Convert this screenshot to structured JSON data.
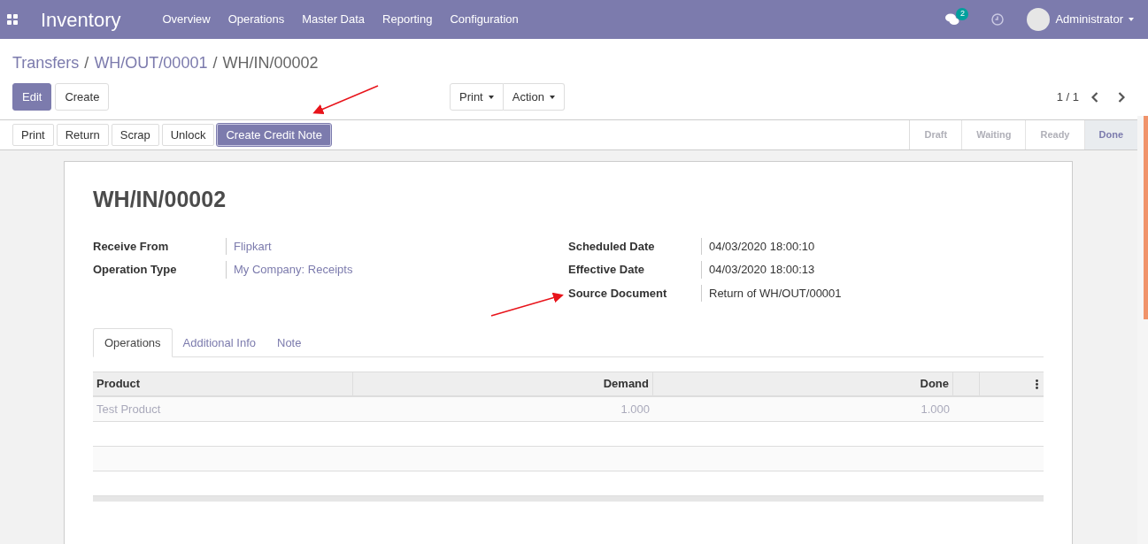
{
  "navbar": {
    "app_name": "Inventory",
    "menu": [
      "Overview",
      "Operations",
      "Master Data",
      "Reporting",
      "Configuration"
    ],
    "message_count": "2",
    "user": "Administrator"
  },
  "breadcrumb_separators": [
    "/",
    "/"
  ],
  "breadcrumb": [
    {
      "label": "Transfers",
      "link": true
    },
    {
      "label": "WH/OUT/00001",
      "link": true
    },
    {
      "label": "WH/IN/00002",
      "link": false
    }
  ],
  "control_buttons": [
    {
      "label": "Edit",
      "primary": true
    },
    {
      "label": "Create",
      "primary": false
    }
  ],
  "dropdowns": [
    "Print",
    "Action"
  ],
  "pager": "1 / 1",
  "action_buttons": [
    {
      "label": "Print",
      "primary": false
    },
    {
      "label": "Return",
      "primary": false
    },
    {
      "label": "Scrap",
      "primary": false
    },
    {
      "label": "Unlock",
      "primary": false
    },
    {
      "label": "Create Credit Note",
      "primary": true
    }
  ],
  "statuses": [
    {
      "label": "Draft",
      "selected": false
    },
    {
      "label": "Waiting",
      "selected": false
    },
    {
      "label": "Ready",
      "selected": false
    },
    {
      "label": "Done",
      "selected": true
    }
  ],
  "record": {
    "title": "WH/IN/00002",
    "left_fields": [
      {
        "label": "Receive From",
        "value": "Flipkart",
        "link": true
      },
      {
        "label": "Operation Type",
        "value": "My Company: Receipts",
        "link": true
      }
    ],
    "right_fields": [
      {
        "label": "Scheduled Date",
        "value": "04/03/2020 18:00:10",
        "link": false
      },
      {
        "label": "Effective Date",
        "value": "04/03/2020 18:00:13",
        "link": false
      },
      {
        "label": "Source Document",
        "value": "Return of WH/OUT/00001",
        "link": false
      }
    ]
  },
  "tabs": [
    {
      "label": "Operations",
      "selected": true
    },
    {
      "label": "Additional Info",
      "selected": false
    },
    {
      "label": "Note",
      "selected": false
    }
  ],
  "table": {
    "columns": [
      "Product",
      "Demand",
      "Done"
    ],
    "rows": [
      [
        "Test Product",
        "1.000",
        "1.000"
      ]
    ]
  }
}
